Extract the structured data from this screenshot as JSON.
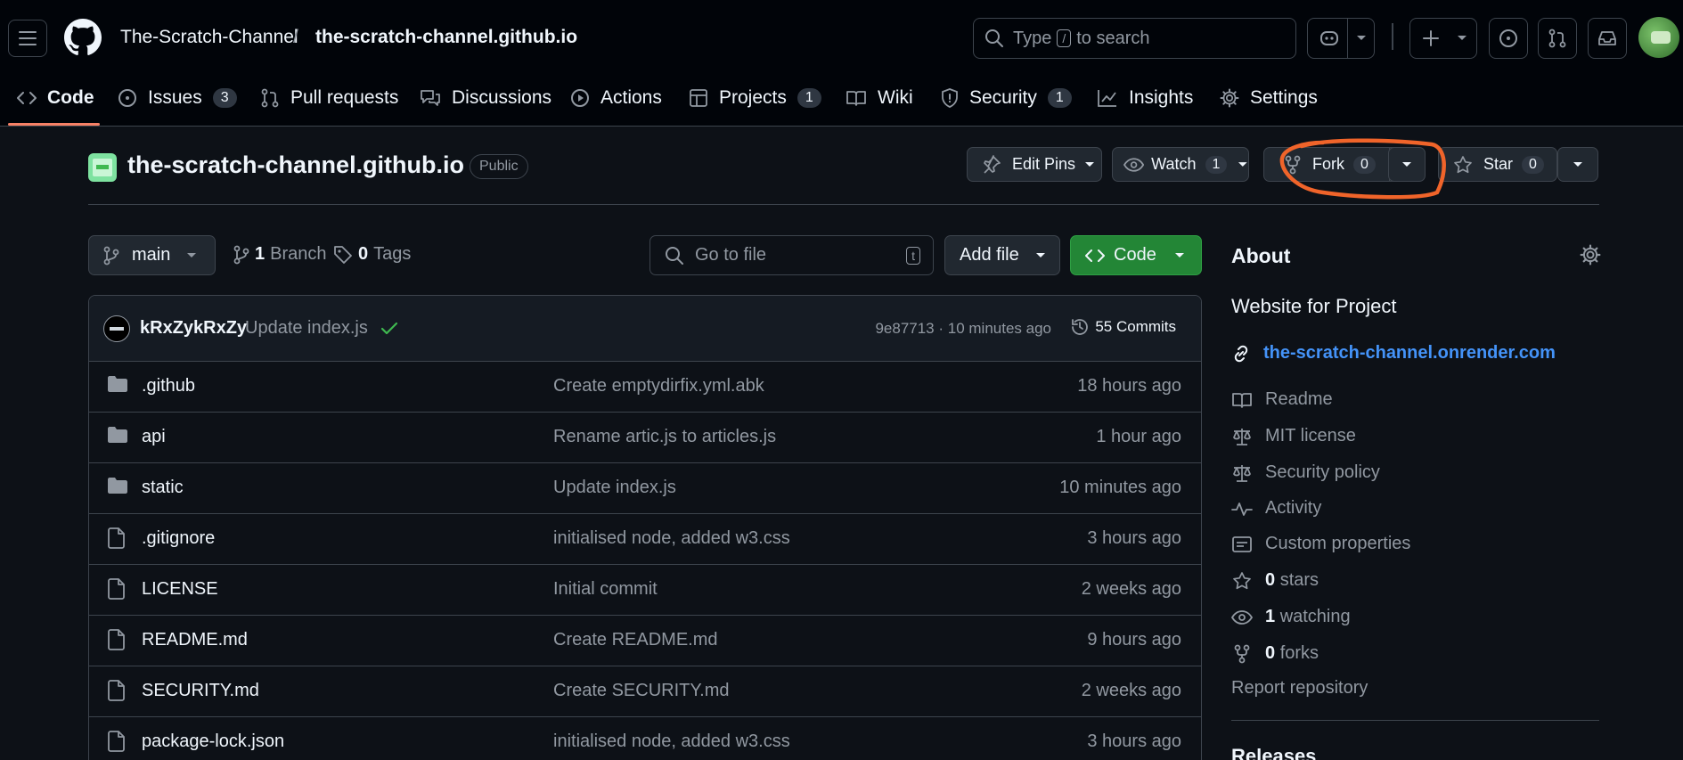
{
  "header": {
    "owner": "The-Scratch-Channel",
    "separator": "/",
    "repo": "the-scratch-channel.github.io",
    "search": {
      "prefix": "Type",
      "key": "/",
      "suffix": "to search"
    }
  },
  "tabs": [
    {
      "label": "Code",
      "count": null
    },
    {
      "label": "Issues",
      "count": "3"
    },
    {
      "label": "Pull requests",
      "count": null
    },
    {
      "label": "Discussions",
      "count": null
    },
    {
      "label": "Actions",
      "count": null
    },
    {
      "label": "Projects",
      "count": "1"
    },
    {
      "label": "Wiki",
      "count": null
    },
    {
      "label": "Security",
      "count": "1"
    },
    {
      "label": "Insights",
      "count": null
    },
    {
      "label": "Settings",
      "count": null
    }
  ],
  "repo_header": {
    "title": "the-scratch-channel.github.io",
    "visibility": "Public",
    "edit_pins": "Edit Pins",
    "watch": {
      "label": "Watch",
      "count": "1"
    },
    "fork": {
      "label": "Fork",
      "count": "0"
    },
    "star": {
      "label": "Star",
      "count": "0"
    }
  },
  "toolbar": {
    "branch": "main",
    "branches": {
      "count": "1",
      "label": "Branch"
    },
    "tags": {
      "count": "0",
      "label": "Tags"
    },
    "goto_placeholder": "Go to file",
    "goto_key": "t",
    "add_file": "Add file",
    "code": "Code"
  },
  "latest_commit": {
    "author": "kRxZykRxZy",
    "message": "Update index.js",
    "meta": "9e87713 · 10 minutes ago",
    "commits": "55 Commits"
  },
  "files": [
    {
      "type": "dir",
      "name": ".github",
      "message": "Create emptydirfix.yml.abk",
      "time": "18 hours ago"
    },
    {
      "type": "dir",
      "name": "api",
      "message": "Rename artic.js to articles.js",
      "time": "1 hour ago"
    },
    {
      "type": "dir",
      "name": "static",
      "message": "Update index.js",
      "time": "10 minutes ago"
    },
    {
      "type": "file",
      "name": ".gitignore",
      "message": "initialised node, added w3.css",
      "time": "3 hours ago"
    },
    {
      "type": "file",
      "name": "LICENSE",
      "message": "Initial commit",
      "time": "2 weeks ago"
    },
    {
      "type": "file",
      "name": "README.md",
      "message": "Create README.md",
      "time": "9 hours ago"
    },
    {
      "type": "file",
      "name": "SECURITY.md",
      "message": "Create SECURITY.md",
      "time": "2 weeks ago"
    },
    {
      "type": "file",
      "name": "package-lock.json",
      "message": "initialised node, added w3.css",
      "time": "3 hours ago"
    }
  ],
  "about": {
    "heading": "About",
    "description": "Website for Project",
    "link": "the-scratch-channel.onrender.com",
    "items": [
      {
        "icon": "book-icon",
        "label": "Readme"
      },
      {
        "icon": "scale-icon",
        "label": "MIT license"
      },
      {
        "icon": "scale-icon",
        "label": "Security policy"
      },
      {
        "icon": "pulse-icon",
        "label": "Activity"
      },
      {
        "icon": "note-icon",
        "label": "Custom properties"
      }
    ],
    "stats": [
      {
        "icon": "star-icon",
        "count": "0",
        "label": "stars"
      },
      {
        "icon": "eye-icon",
        "count": "1",
        "label": "watching"
      },
      {
        "icon": "fork-icon",
        "count": "0",
        "label": "forks"
      }
    ],
    "report": "Report repository",
    "releases": "Releases"
  },
  "colors": {
    "background": "#0d1117",
    "header_bg": "#010409",
    "border": "#3d444d",
    "accent_link": "#4493f8",
    "green_button": "#238636",
    "tab_underline": "#f78166",
    "annotation": "#f0642a"
  }
}
